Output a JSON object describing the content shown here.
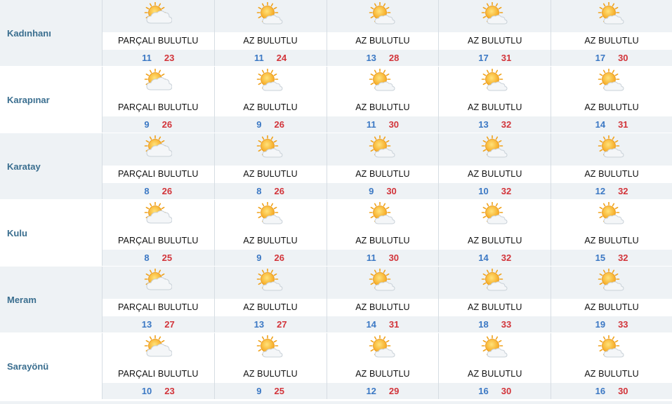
{
  "rows": [
    {
      "city": "Kadınhanı",
      "days": [
        {
          "cond": "PARÇALI BULUTLU",
          "min": "11",
          "max": "23",
          "icon": "partly-cloudy-icon"
        },
        {
          "cond": "AZ BULUTLU",
          "min": "11",
          "max": "24",
          "icon": "mostly-sunny-icon"
        },
        {
          "cond": "AZ BULUTLU",
          "min": "13",
          "max": "28",
          "icon": "mostly-sunny-icon"
        },
        {
          "cond": "AZ BULUTLU",
          "min": "17",
          "max": "31",
          "icon": "mostly-sunny-icon"
        },
        {
          "cond": "AZ BULUTLU",
          "min": "17",
          "max": "30",
          "icon": "mostly-sunny-icon"
        }
      ]
    },
    {
      "city": "Karapınar",
      "days": [
        {
          "cond": "PARÇALI BULUTLU",
          "min": "9",
          "max": "26",
          "icon": "partly-cloudy-icon"
        },
        {
          "cond": "AZ BULUTLU",
          "min": "9",
          "max": "26",
          "icon": "mostly-sunny-icon"
        },
        {
          "cond": "AZ BULUTLU",
          "min": "11",
          "max": "30",
          "icon": "mostly-sunny-icon"
        },
        {
          "cond": "AZ BULUTLU",
          "min": "13",
          "max": "32",
          "icon": "mostly-sunny-icon"
        },
        {
          "cond": "AZ BULUTLU",
          "min": "14",
          "max": "31",
          "icon": "mostly-sunny-icon"
        }
      ]
    },
    {
      "city": "Karatay",
      "days": [
        {
          "cond": "PARÇALI BULUTLU",
          "min": "8",
          "max": "26",
          "icon": "partly-cloudy-icon"
        },
        {
          "cond": "AZ BULUTLU",
          "min": "8",
          "max": "26",
          "icon": "mostly-sunny-icon"
        },
        {
          "cond": "AZ BULUTLU",
          "min": "9",
          "max": "30",
          "icon": "mostly-sunny-icon"
        },
        {
          "cond": "AZ BULUTLU",
          "min": "10",
          "max": "32",
          "icon": "mostly-sunny-icon"
        },
        {
          "cond": "AZ BULUTLU",
          "min": "12",
          "max": "32",
          "icon": "mostly-sunny-icon"
        }
      ]
    },
    {
      "city": "Kulu",
      "days": [
        {
          "cond": "PARÇALI BULUTLU",
          "min": "8",
          "max": "25",
          "icon": "partly-cloudy-icon"
        },
        {
          "cond": "AZ BULUTLU",
          "min": "9",
          "max": "26",
          "icon": "mostly-sunny-icon"
        },
        {
          "cond": "AZ BULUTLU",
          "min": "11",
          "max": "30",
          "icon": "mostly-sunny-icon"
        },
        {
          "cond": "AZ BULUTLU",
          "min": "14",
          "max": "32",
          "icon": "mostly-sunny-icon"
        },
        {
          "cond": "AZ BULUTLU",
          "min": "15",
          "max": "32",
          "icon": "mostly-sunny-icon"
        }
      ]
    },
    {
      "city": "Meram",
      "days": [
        {
          "cond": "PARÇALI BULUTLU",
          "min": "13",
          "max": "27",
          "icon": "partly-cloudy-icon"
        },
        {
          "cond": "AZ BULUTLU",
          "min": "13",
          "max": "27",
          "icon": "mostly-sunny-icon"
        },
        {
          "cond": "AZ BULUTLU",
          "min": "14",
          "max": "31",
          "icon": "mostly-sunny-icon"
        },
        {
          "cond": "AZ BULUTLU",
          "min": "18",
          "max": "33",
          "icon": "mostly-sunny-icon"
        },
        {
          "cond": "AZ BULUTLU",
          "min": "19",
          "max": "33",
          "icon": "mostly-sunny-icon"
        }
      ]
    },
    {
      "city": "Sarayönü",
      "days": [
        {
          "cond": "PARÇALI BULUTLU",
          "min": "10",
          "max": "23",
          "icon": "partly-cloudy-icon"
        },
        {
          "cond": "AZ BULUTLU",
          "min": "9",
          "max": "25",
          "icon": "mostly-sunny-icon"
        },
        {
          "cond": "AZ BULUTLU",
          "min": "12",
          "max": "29",
          "icon": "mostly-sunny-icon"
        },
        {
          "cond": "AZ BULUTLU",
          "min": "16",
          "max": "30",
          "icon": "mostly-sunny-icon"
        },
        {
          "cond": "AZ BULUTLU",
          "min": "16",
          "max": "30",
          "icon": "mostly-sunny-icon"
        }
      ]
    }
  ],
  "colors": {
    "min": "#3b78c4",
    "max": "#d2343a",
    "city": "#3a6e8f",
    "band": "#eef2f5"
  }
}
